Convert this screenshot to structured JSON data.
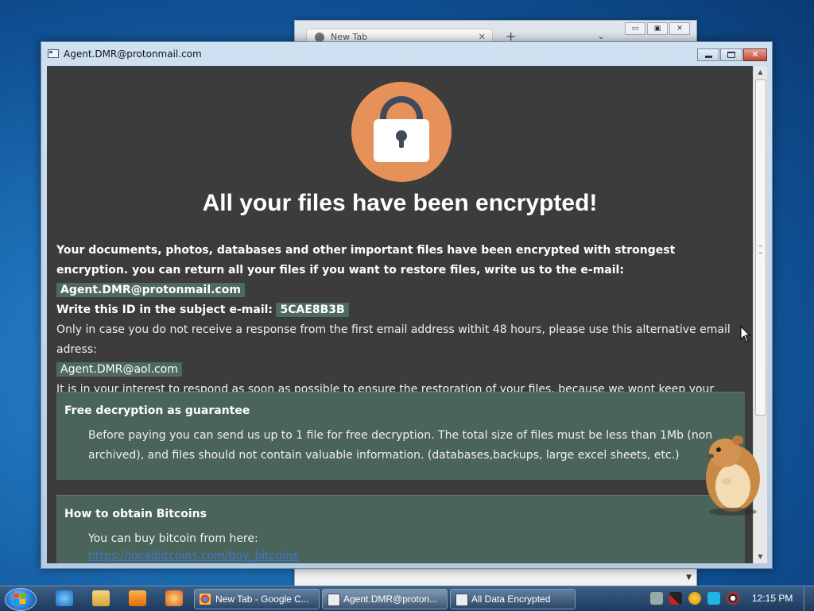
{
  "background_window": {
    "tab_label": "New Tab",
    "tab_close": "✕",
    "new_tab": "+",
    "tab_menu": "⌄",
    "controls": [
      "▭",
      "▣",
      "✕"
    ]
  },
  "window": {
    "title": "Agent.DMR@protonmail.com",
    "controls": {
      "minimize": "",
      "maximize": "",
      "close": "✕"
    }
  },
  "note": {
    "headline": "All your files have been encrypted!",
    "para1_text": "Your documents, photos, databases and other important files have been encrypted with strongest encryption. you can return all your files if you want to restore files, write us to the e-mail:",
    "email_primary": "Agent.DMR@protonmail.com",
    "id_label": "Write this ID in the subject e-mail:",
    "id_value": "5CAE8B3B",
    "alt_text": "Only in case you do not receive a response from the first email address withit 48 hours, please use this alternative email adress:",
    "email_alt": "Agent.DMR@aol.com",
    "interest_text": "It is in your interest to respond as soon as possible to ensure the restoration of your files, because we wont keep your decryption keys at our server more than one week. The price depends on how fast you write to us."
  },
  "panels": [
    {
      "title": "Free decryption as guarantee",
      "body": "Before paying you can send us up to 1 file for free decryption. The total size of files must be less than 1Mb (non archived), and files should not contain valuable information. (databases,backups, large excel sheets, etc.)"
    },
    {
      "title": "How to obtain Bitcoins",
      "body": "You can buy bitcoin from here:",
      "link": "https://localbitcoins.com/buy_bitcoins"
    }
  ],
  "taskbar": {
    "tasks": [
      {
        "label": "New Tab - Google C...",
        "icon": "chrome-icon",
        "active": false
      },
      {
        "label": "Agent.DMR@proton...",
        "icon": "window-icon",
        "active": true
      },
      {
        "label": "All Data Encrypted",
        "icon": "window-icon",
        "active": false
      }
    ],
    "clock": "12:15 PM"
  },
  "colors": {
    "note_background": "#3c3c3c",
    "highlight": "#4e6a5f",
    "panel": "#4a6459",
    "lock_circle": "#e6915a",
    "link": "#3b78d6"
  }
}
